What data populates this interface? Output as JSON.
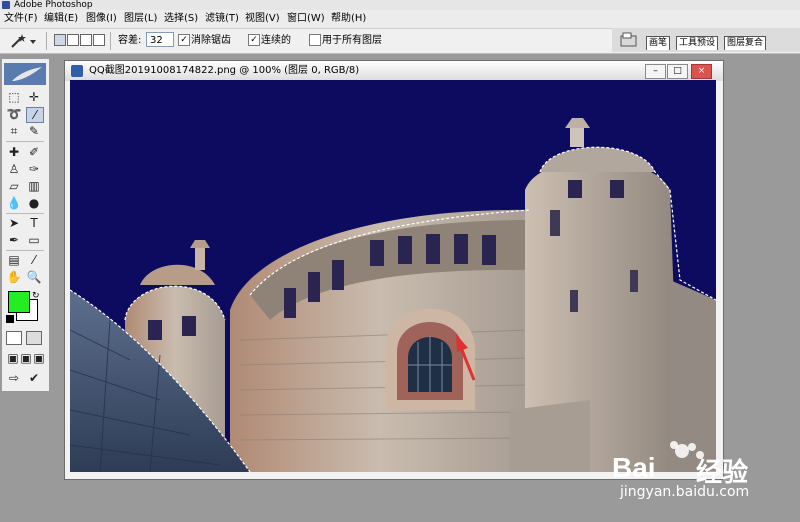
{
  "app": {
    "title": "Adobe Photoshop"
  },
  "menu": {
    "items": [
      {
        "label": "文件(F)"
      },
      {
        "label": "编辑(E)"
      },
      {
        "label": "图像(I)"
      },
      {
        "label": "图层(L)"
      },
      {
        "label": "选择(S)"
      },
      {
        "label": "滤镜(T)"
      },
      {
        "label": "视图(V)"
      },
      {
        "label": "窗口(W)"
      },
      {
        "label": "帮助(H)"
      }
    ]
  },
  "options": {
    "tolerance_label": "容差:",
    "tolerance_value": "32",
    "antialias_label": "消除锯齿",
    "antialias_checked": "✓",
    "contiguous_label": "连续的",
    "contiguous_checked": "✓",
    "all_layers_label": "用于所有图层",
    "all_layers_checked": ""
  },
  "palette_well": {
    "tabs": [
      {
        "label": "画笔"
      },
      {
        "label": "工具预设"
      },
      {
        "label": "图层复合"
      }
    ]
  },
  "document": {
    "title": "QQ截图20191008174822.png @ 100% (图层 0, RGB/8)",
    "minimize": "–",
    "maximize": "□",
    "close": "×"
  },
  "colors": {
    "foreground": "#22ee22",
    "background": "#ffffff",
    "canvas_background": "#0c0b5f"
  },
  "watermark": {
    "brand": "Bai",
    "brand_cn": "经验",
    "url": "jingyan.baidu.com"
  }
}
